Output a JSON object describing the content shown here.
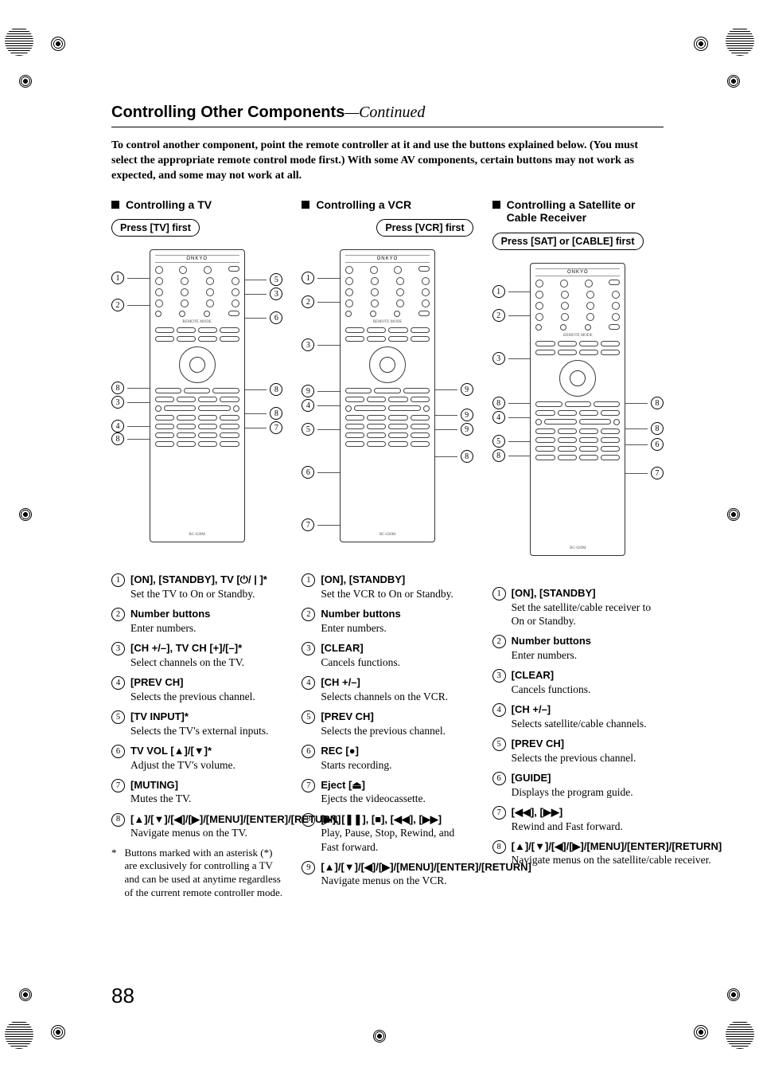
{
  "page_number": "88",
  "title_main": "Controlling Other Components",
  "title_cont": "—Continued",
  "intro": "To control another component, point the remote controller at it and use the buttons explained below. (You must select the appropriate remote control mode first.) With some AV components, certain buttons may not work as expected, and some may not work at all.",
  "brand": "ONKYO",
  "remote_model": "RC-620M",
  "tiny_remote_label": "REMOTE MODE",
  "columns": [
    {
      "heading": "Controlling a TV",
      "press": "Press [TV] first",
      "callouts_left": [
        "1",
        "2",
        "8",
        "3",
        "4",
        "8"
      ],
      "callouts_right": [
        "5",
        "3",
        "6",
        "8",
        "8",
        "7"
      ],
      "items": [
        {
          "n": "1",
          "label": "[ON], [STANDBY], TV [⏻/ | ]*",
          "desc": "Set the TV to On or Standby."
        },
        {
          "n": "2",
          "label": "Number buttons",
          "desc": "Enter numbers."
        },
        {
          "n": "3",
          "label": "[CH +/–], TV CH [+]/[–]*",
          "desc": "Select channels on the TV."
        },
        {
          "n": "4",
          "label": "[PREV CH]",
          "desc": "Selects the previous channel."
        },
        {
          "n": "5",
          "label": "[TV INPUT]*",
          "desc": "Selects the TV's external inputs."
        },
        {
          "n": "6",
          "label": "TV VOL [▲]/[▼]*",
          "desc": "Adjust the TV's volume."
        },
        {
          "n": "7",
          "label": "[MUTING]",
          "desc": "Mutes the TV."
        },
        {
          "n": "8",
          "label": "[▲]/[▼]/[◀]/[▶]/[MENU]/[ENTER]/[RETURN]",
          "desc": "Navigate menus on the TV."
        }
      ],
      "footnote": "Buttons marked with an asterisk (*) are exclusively for controlling a TV and can be used at anytime regardless of the current remote controller mode."
    },
    {
      "heading": "Controlling a VCR",
      "press": "Press [VCR] first",
      "callouts_left": [
        "1",
        "2",
        "3",
        "9",
        "4",
        "5",
        "6",
        "7"
      ],
      "callouts_right": [
        "9",
        "9",
        "9",
        "8"
      ],
      "items": [
        {
          "n": "1",
          "label": "[ON], [STANDBY]",
          "desc": "Set the VCR to On or Standby."
        },
        {
          "n": "2",
          "label": "Number buttons",
          "desc": "Enter numbers."
        },
        {
          "n": "3",
          "label": "[CLEAR]",
          "desc": "Cancels functions."
        },
        {
          "n": "4",
          "label": "[CH +/–]",
          "desc": "Selects channels on the VCR."
        },
        {
          "n": "5",
          "label": "[PREV CH]",
          "desc": "Selects the previous channel."
        },
        {
          "n": "6",
          "label": "REC [●]",
          "desc": "Starts recording."
        },
        {
          "n": "7",
          "label": "Eject [⏏]",
          "desc": "Ejects the videocassette."
        },
        {
          "n": "8",
          "label": "[▶], [❚❚], [■], [◀◀], [▶▶]",
          "desc": "Play, Pause, Stop, Rewind, and Fast forward."
        },
        {
          "n": "9",
          "label": "[▲]/[▼]/[◀]/[▶]/[MENU]/[ENTER]/[RETURN]",
          "desc": "Navigate menus on the VCR."
        }
      ]
    },
    {
      "heading": "Controlling a Satellite or Cable Receiver",
      "press": "Press [SAT] or [CABLE] first",
      "callouts_left": [
        "1",
        "2",
        "3",
        "8",
        "4",
        "5",
        "8"
      ],
      "callouts_right": [
        "8",
        "8",
        "6",
        "7"
      ],
      "items": [
        {
          "n": "1",
          "label": "[ON], [STANDBY]",
          "desc": "Set the satellite/cable receiver to On or Standby."
        },
        {
          "n": "2",
          "label": "Number buttons",
          "desc": "Enter numbers."
        },
        {
          "n": "3",
          "label": "[CLEAR]",
          "desc": "Cancels functions."
        },
        {
          "n": "4",
          "label": "[CH +/–]",
          "desc": "Selects satellite/cable channels."
        },
        {
          "n": "5",
          "label": "[PREV CH]",
          "desc": "Selects the previous channel."
        },
        {
          "n": "6",
          "label": "[GUIDE]",
          "desc": "Displays the program guide."
        },
        {
          "n": "7",
          "label": "[◀◀], [▶▶]",
          "desc": "Rewind and Fast forward."
        },
        {
          "n": "8",
          "label": "[▲]/[▼]/[◀]/[▶]/[MENU]/[ENTER]/[RETURN]",
          "desc": "Navigate menus on the satellite/cable receiver."
        }
      ]
    }
  ]
}
